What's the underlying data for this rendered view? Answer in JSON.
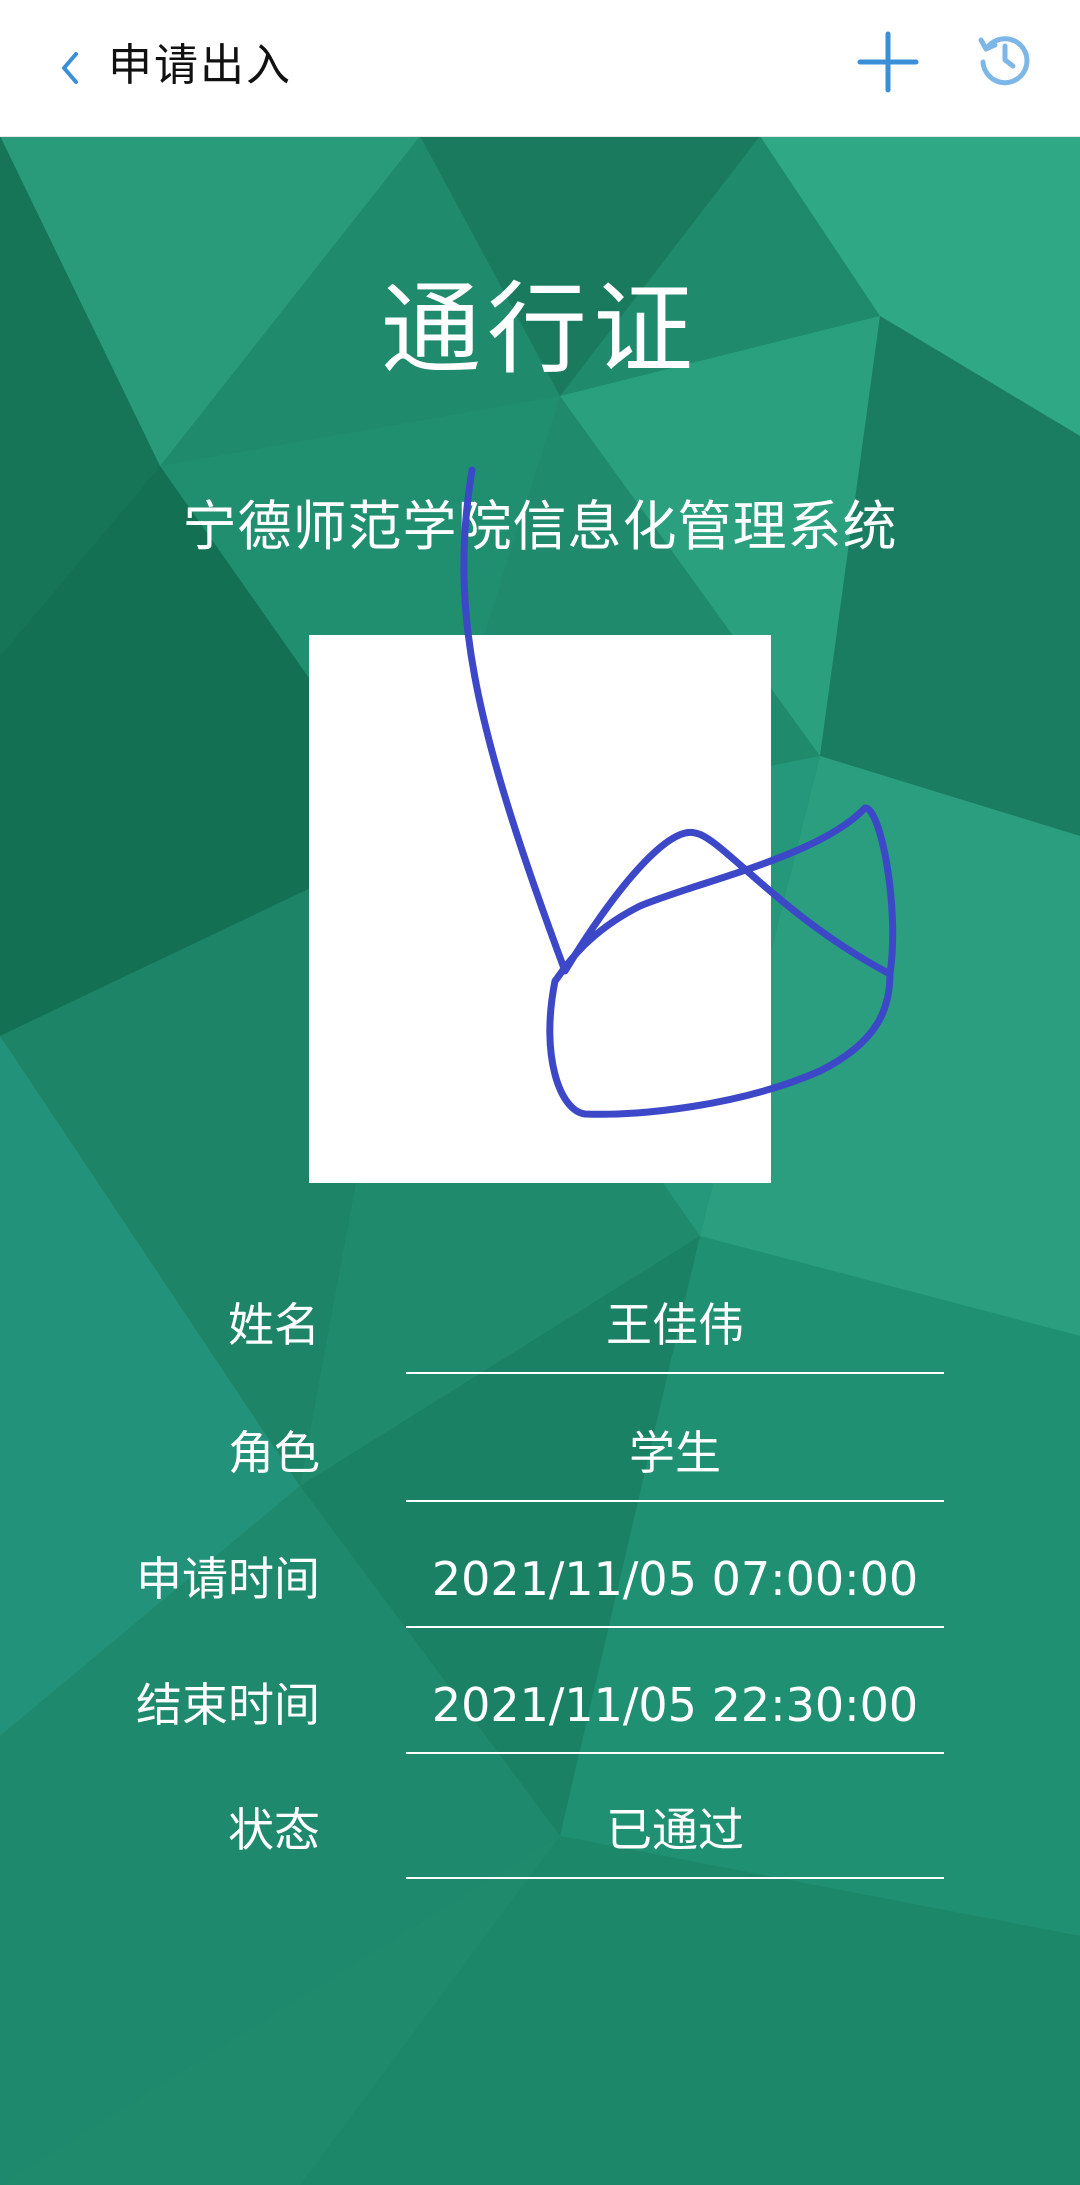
{
  "header": {
    "title": "申请出入",
    "back_icon": "chevron-left-icon",
    "add_icon": "plus-icon",
    "history_icon": "history-icon",
    "accent_color": "#3a8fd6"
  },
  "pass": {
    "title": "通行证",
    "school": "宁德师范学院信息化管理系统",
    "background_color": "#1f8a6c"
  },
  "fields": [
    {
      "label": "姓名",
      "value": "王佳伟"
    },
    {
      "label": "角色",
      "value": "学生"
    },
    {
      "label": "申请时间",
      "value": "2021/11/05 07:00:00"
    },
    {
      "label": "结束时间",
      "value": "2021/11/05 22:30:00"
    },
    {
      "label": "状态",
      "value": "已通过"
    }
  ]
}
